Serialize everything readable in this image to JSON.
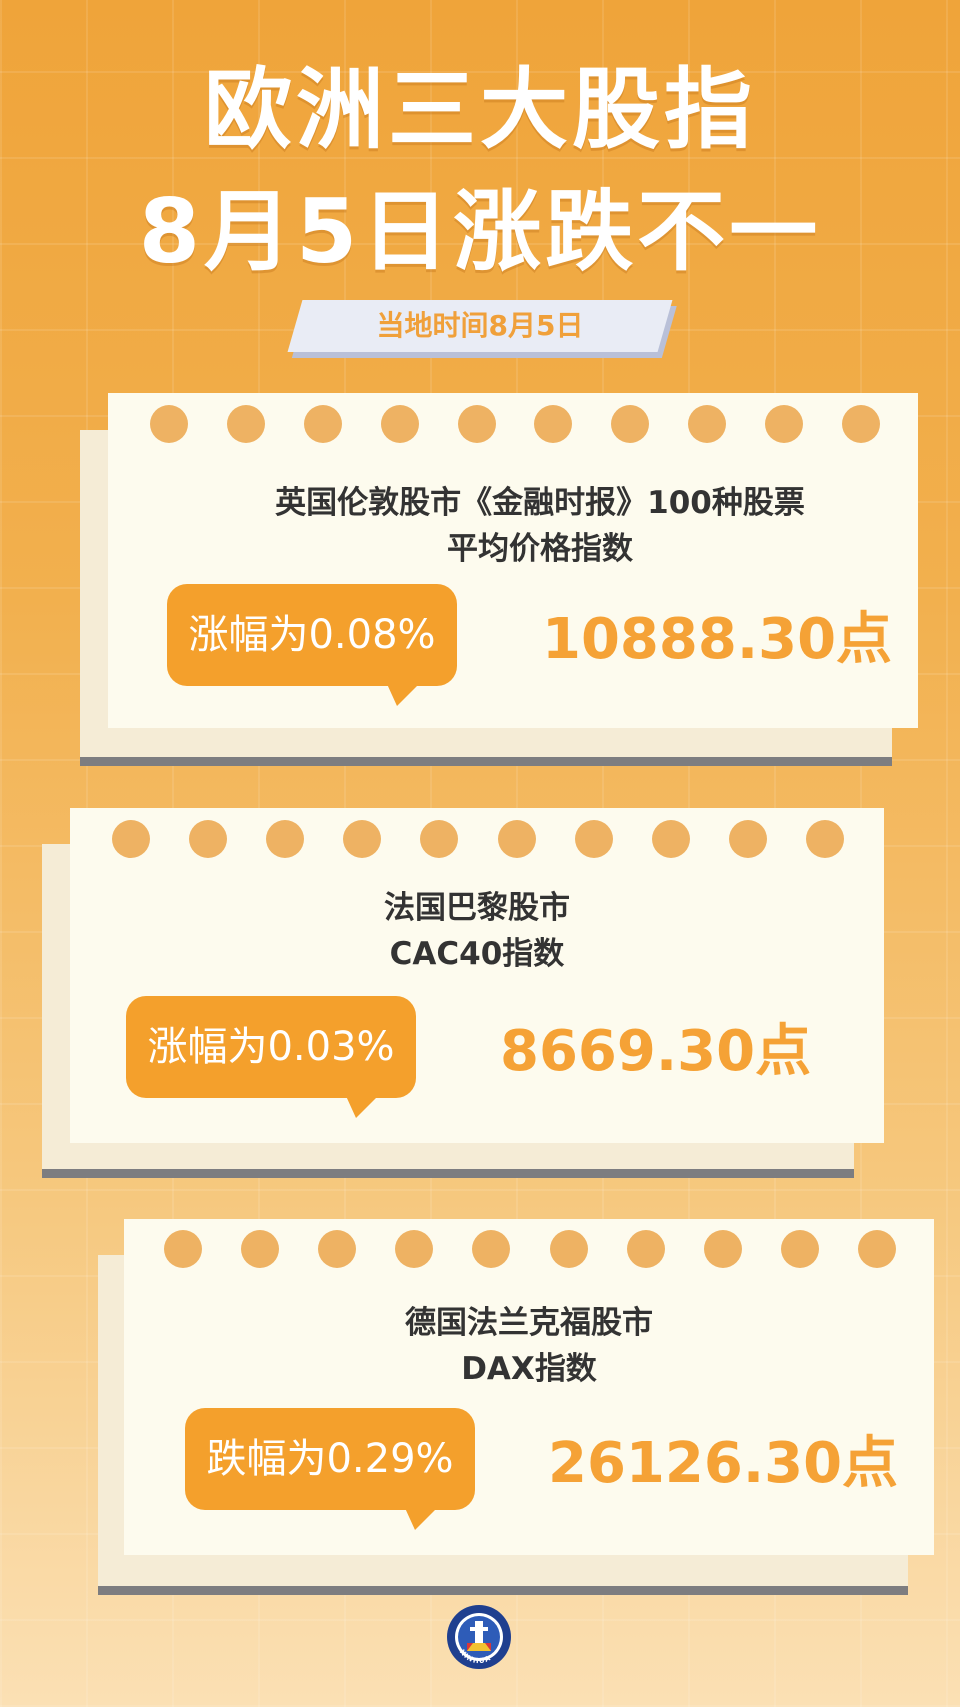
{
  "header": {
    "title_line1": "欧洲三大股指",
    "title_line2": "8月5日涨跌不一",
    "date_tag": "当地时间8月5日"
  },
  "cards": [
    {
      "title_line1": "英国伦敦股市《金融时报》100种股票",
      "title_line2": "平均价格指数",
      "change": "涨幅为0.08%",
      "value": "10888.30点"
    },
    {
      "title_line1": "法国巴黎股市",
      "title_line2": "CAC40指数",
      "change": "涨幅为0.03%",
      "value": "8669.30点"
    },
    {
      "title_line1": "德国法兰克福股市",
      "title_line2": "DAX指数",
      "change": "跌幅为0.29%",
      "value": "26126.30点"
    }
  ],
  "footer": {
    "logo_text": "XINHUA"
  },
  "colors": {
    "orange": "#f4a02c",
    "paper": "#fdfbee",
    "hole": "#eeb263"
  }
}
